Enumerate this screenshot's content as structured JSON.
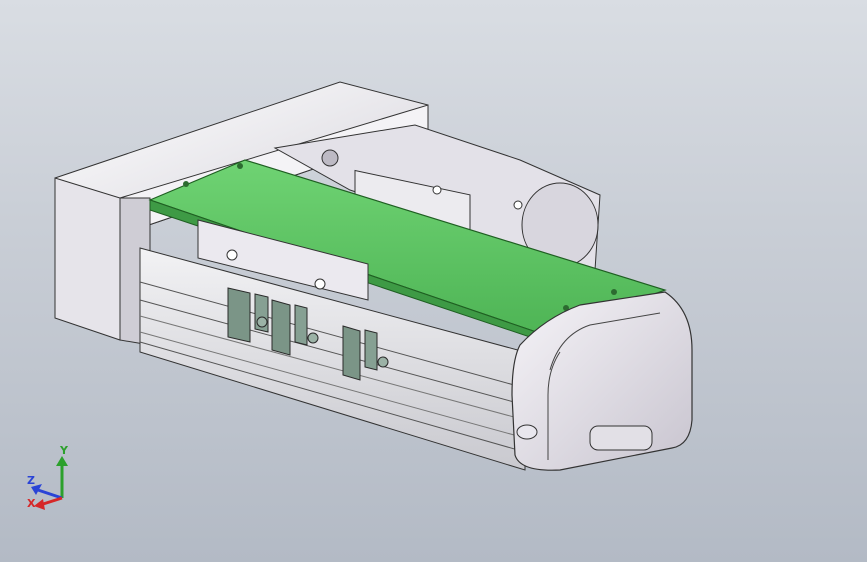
{
  "model": {
    "description_colors": {
      "background_top": "#d9dde3",
      "background_bottom": "#b3bac5",
      "carriage_plate": "#5fc765",
      "housing": "#e9e7ec",
      "rail_body": "#d8d8dc",
      "sensor": "#7b9587",
      "edge": "#2a2a2a"
    }
  },
  "triad": {
    "y_label": "Y",
    "z_label": "Z",
    "x_label": "X",
    "y_color": "#2ca02c",
    "z_color": "#2a44d6",
    "x_color": "#d62728"
  }
}
